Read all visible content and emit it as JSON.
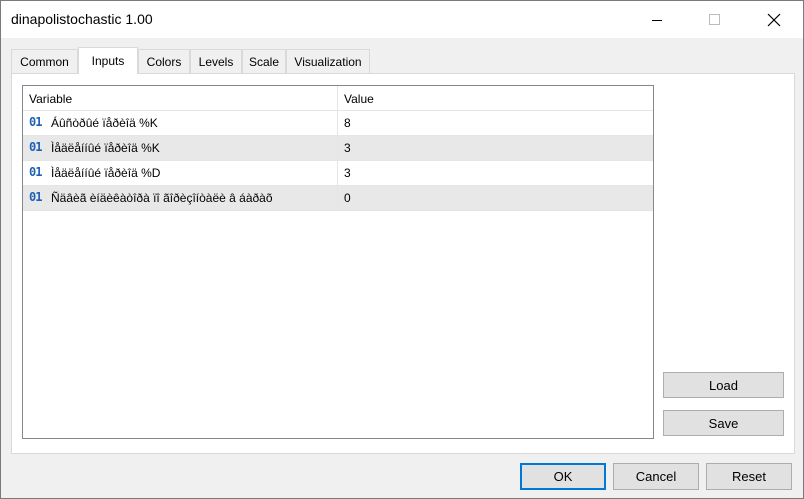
{
  "window": {
    "title": "dinapolistochastic 1.00"
  },
  "tabs": [
    {
      "label": "Common"
    },
    {
      "label": "Inputs",
      "active": true
    },
    {
      "label": "Colors"
    },
    {
      "label": "Levels"
    },
    {
      "label": "Scale"
    },
    {
      "label": "Visualization"
    }
  ],
  "grid": {
    "columns": [
      "Variable",
      "Value"
    ],
    "rows": [
      {
        "type_badge": "01",
        "variable": "Áûñòðûé ïåðèîä %K",
        "value": "8"
      },
      {
        "type_badge": "01",
        "variable": "Ìåäëåííûé ïåðèîä %K",
        "value": "3"
      },
      {
        "type_badge": "01",
        "variable": "Ìåäëåííûé ïåðèîä %D",
        "value": "3"
      },
      {
        "type_badge": "01",
        "variable": "Ñäâèã èíäèêàòîðà ïî ãîðèçîíòàëè â áàðàõ",
        "value": "0"
      }
    ]
  },
  "side_buttons": {
    "load": "Load",
    "save": "Save"
  },
  "footer": {
    "ok": "OK",
    "cancel": "Cancel",
    "reset": "Reset"
  },
  "colors": {
    "accent": "#0078d7",
    "badge": "#1f5fb4"
  },
  "icons": {
    "minimize": "minimize-icon",
    "maximize": "maximize-icon",
    "close": "close-icon",
    "type_badge": "integer-type-icon"
  }
}
